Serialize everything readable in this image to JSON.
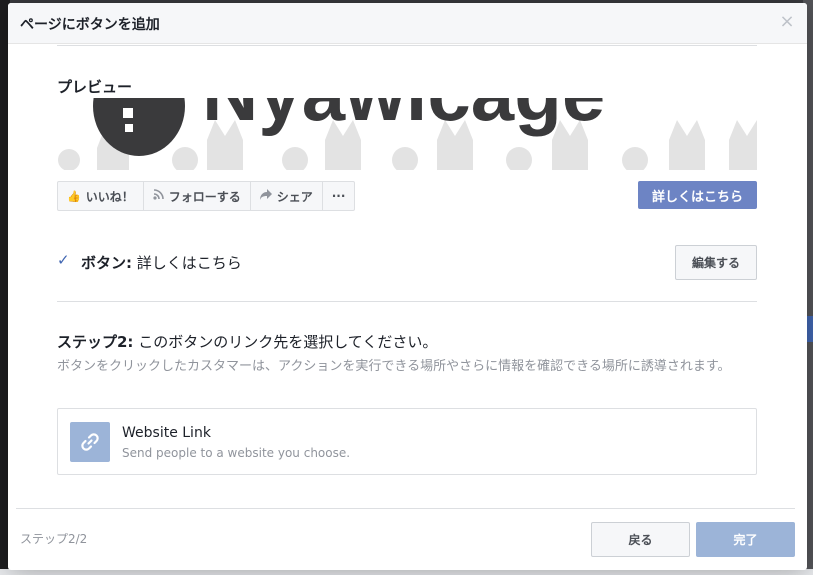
{
  "dialog": {
    "title": "ページにボタンを追加",
    "close_symbol": "×"
  },
  "preview": {
    "label": "プレビュー",
    "cover_text": "Nyawicage",
    "action_bar": [
      {
        "label": "いいね！",
        "icon": "thumbs-up-icon"
      },
      {
        "label": "フォローする",
        "icon": "rss-icon"
      },
      {
        "label": "シェア",
        "icon": "share-arrow-icon"
      },
      {
        "label": "···",
        "icon": "more-icon"
      }
    ],
    "cta_label": "詳しくはこちら"
  },
  "selected_button": {
    "prefix": "ボタン:",
    "value": "詳しくはこちら",
    "edit_label": "編集する"
  },
  "step": {
    "title_prefix": "ステップ2:",
    "title": "このボタンのリンク先を選択してください。",
    "description": "ボタンをクリックしたカスタマーは、アクションを実行できる場所やさらに情報を確認できる場所に誘導されます。"
  },
  "options": [
    {
      "title": "Website Link",
      "subtitle": "Send people to a website you choose.",
      "icon": "link-icon"
    }
  ],
  "footer": {
    "step_count": "ステップ2/2",
    "back_label": "戻る",
    "done_label": "完了"
  },
  "colors": {
    "accent": "#4267b2",
    "cta": "#6d84c4",
    "disabled_primary": "#9cb4d8"
  }
}
